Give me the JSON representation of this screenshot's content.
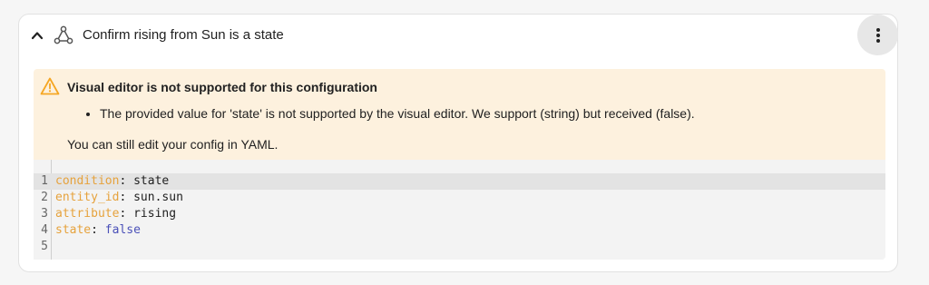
{
  "card": {
    "title": "Confirm rising from Sun is a state",
    "collapse_icon": "chevron-up-icon",
    "type_icon": "condition-icon",
    "menu_icon": "dots-vertical-icon"
  },
  "warning": {
    "icon": "alert-triangle-icon",
    "title": "Visual editor is not supported for this configuration",
    "items": [
      "The provided value for 'state' is not supported by the visual editor. We support (string) but received (false)."
    ],
    "note": "You can still edit your config in YAML.",
    "background_color": "#fdf1de",
    "icon_color": "#f5a623"
  },
  "editor": {
    "lines": [
      {
        "num": "1",
        "key": "condition",
        "sep": ": ",
        "value": "state",
        "value_type": "string"
      },
      {
        "num": "2",
        "key": "entity_id",
        "sep": ": ",
        "value": "sun.sun",
        "value_type": "string"
      },
      {
        "num": "3",
        "key": "attribute",
        "sep": ": ",
        "value": "rising",
        "value_type": "string"
      },
      {
        "num": "4",
        "key": "state",
        "sep": ": ",
        "value": "false",
        "value_type": "bool"
      },
      {
        "num": "5",
        "key": "",
        "sep": "",
        "value": "",
        "value_type": "string"
      }
    ],
    "key_color": "#e6a23c",
    "bool_color": "#4a50b8"
  }
}
